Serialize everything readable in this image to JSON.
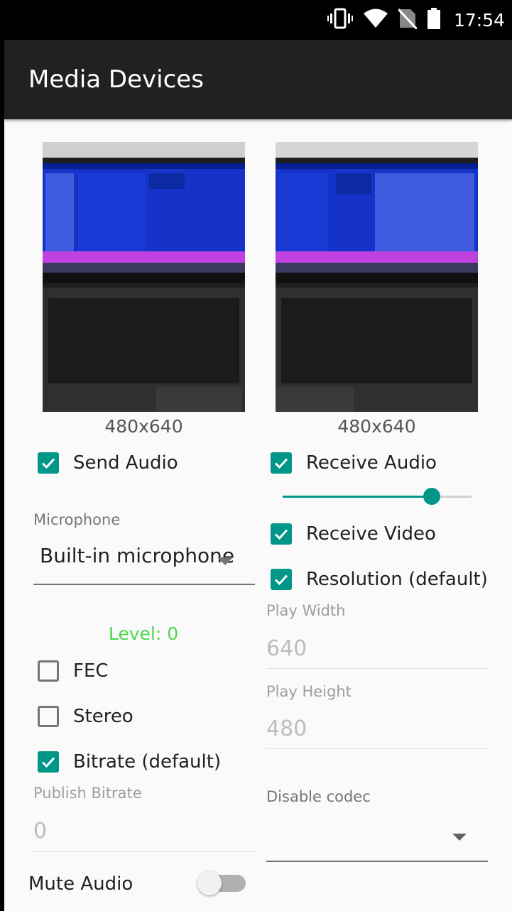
{
  "status_bar": {
    "time": "17:54",
    "icons": [
      "vibrate-icon",
      "wifi-icon",
      "no-sim-icon",
      "battery-icon"
    ]
  },
  "app_bar": {
    "title": "Media Devices"
  },
  "colors": {
    "accent": "#009688",
    "level": "#4cd94c",
    "app_bar": "#212121"
  },
  "publish": {
    "resolution": "480x640",
    "send_audio": {
      "label": "Send Audio",
      "checked": true
    },
    "microphone": {
      "label": "Microphone",
      "value": "Built-in microphone"
    },
    "level": "Level: 0",
    "fec": {
      "label": "FEC",
      "checked": false
    },
    "stereo": {
      "label": "Stereo",
      "checked": false
    },
    "bitrate": {
      "label": "Bitrate (default)",
      "checked": true
    },
    "publish_bitrate": {
      "label": "Publish Bitrate",
      "value": "0"
    },
    "mute_audio": {
      "label": "Mute Audio",
      "on": false
    }
  },
  "play": {
    "resolution": "480x640",
    "receive_audio": {
      "label": "Receive Audio",
      "checked": true
    },
    "volume_fraction": 0.79,
    "receive_video": {
      "label": "Receive Video",
      "checked": true
    },
    "resolution_default": {
      "label": "Resolution (default)",
      "checked": true
    },
    "play_width": {
      "label": "Play Width",
      "value": "640"
    },
    "play_height": {
      "label": "Play Height",
      "value": "480"
    },
    "disable_codec": {
      "label": "Disable codec",
      "value": ""
    }
  }
}
